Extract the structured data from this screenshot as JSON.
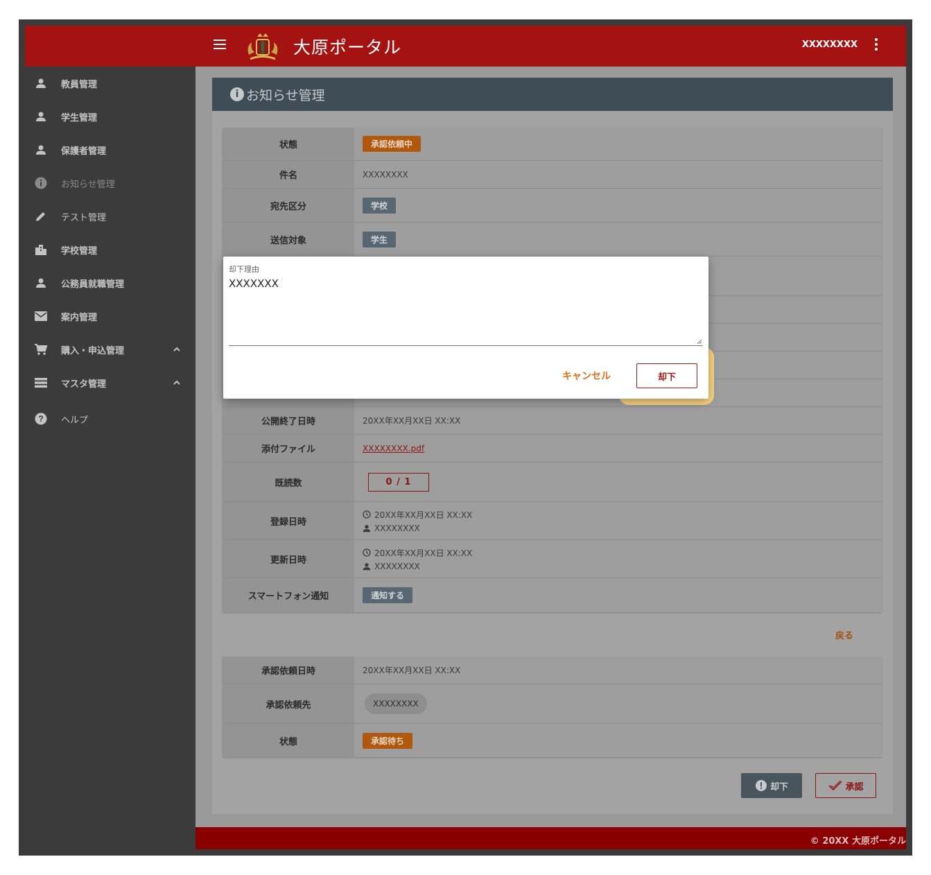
{
  "header": {
    "app_title": "大原ポータル",
    "user_name": "XXXXXXXX"
  },
  "sidebar": {
    "items": [
      {
        "label": "教員管理",
        "icon": "person-icon"
      },
      {
        "label": "学生管理",
        "icon": "person-icon"
      },
      {
        "label": "保護者管理",
        "icon": "person-icon"
      },
      {
        "label": "お知らせ管理",
        "icon": "info-icon"
      },
      {
        "label": "テスト管理",
        "icon": "pencil-icon"
      },
      {
        "label": "学校管理",
        "icon": "building-icon"
      },
      {
        "label": "公務員就職管理",
        "icon": "person-icon"
      },
      {
        "label": "案内管理",
        "icon": "mail-icon"
      },
      {
        "label": "購入・申込管理",
        "icon": "cart-icon"
      },
      {
        "label": "マスタ管理",
        "icon": "list-icon"
      },
      {
        "label": "ヘルプ",
        "icon": "help-icon"
      }
    ]
  },
  "page": {
    "title": "お知らせ管理"
  },
  "detail": {
    "status_label": "状態",
    "status_value": "承認依頼中",
    "subject_label": "件名",
    "subject_value": "XXXXXXXX",
    "dest_label": "宛先区分",
    "dest_value": "学校",
    "target_label": "送信対象",
    "target_value": "学生",
    "end_label": "公開終了日時",
    "end_value": "20XX年XX月XX日 XX:XX",
    "attach_label": "添付ファイル",
    "attach_value": "XXXXXXXX.pdf",
    "read_label": "既読数",
    "read_value": "0 / 1",
    "created_label": "登録日時",
    "created_date": "20XX年XX月XX日 XX:XX",
    "created_user": "XXXXXXXX",
    "updated_label": "更新日時",
    "updated_date": "20XX年XX月XX日 XX:XX",
    "updated_user": "XXXXXXXX",
    "push_label": "スマートフォン通知",
    "push_value": "通知する"
  },
  "back_label": "戻る",
  "approval": {
    "date_label": "承認依頼日時",
    "date_value": "20XX年XX月XX日 XX:XX",
    "to_label": "承認依頼先",
    "to_value": "XXXXXXXX",
    "status_label": "状態",
    "status_value": "承認待ち"
  },
  "actions": {
    "reject": "却下",
    "approve": "承認"
  },
  "footer": {
    "text": "© 20XX 大原ポータル"
  },
  "dialog": {
    "field_label": "却下理由",
    "field_value": "XXXXXXX",
    "cancel": "キャンセル",
    "reject": "却下"
  },
  "colors": {
    "brand_red": "#a51212",
    "accent_orange": "#e0701a",
    "highlight": "#fbd582"
  }
}
